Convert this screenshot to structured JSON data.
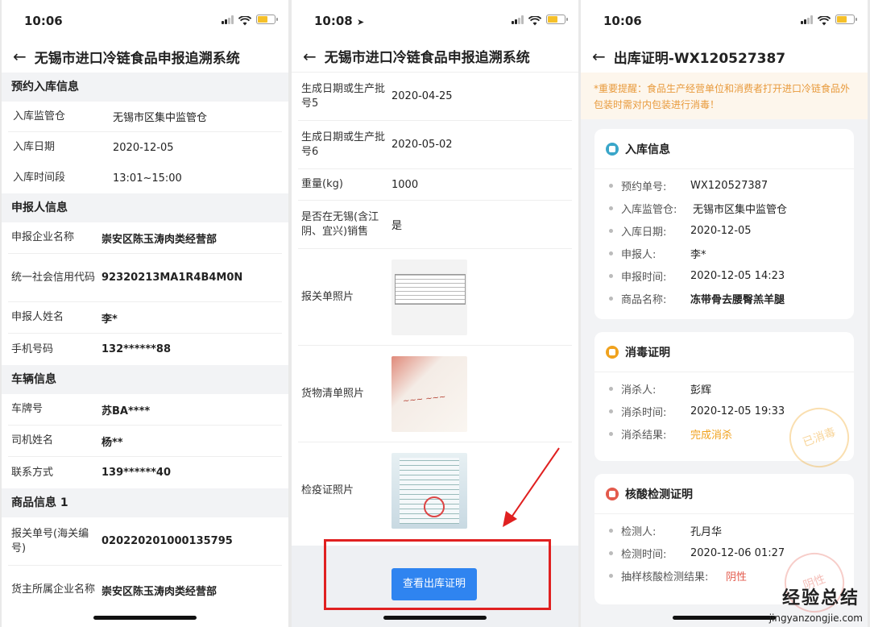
{
  "phone1": {
    "time": "10:06",
    "title": "无锡市进口冷链食品申报追溯系统",
    "section_booking": "预约入库信息",
    "booking": [
      {
        "k": "入库监管仓",
        "v": "无锡市区集中监管仓"
      },
      {
        "k": "入库日期",
        "v": "2020-12-05"
      },
      {
        "k": "入库时间段",
        "v": "13:01~15:00"
      }
    ],
    "section_declarer": "申报人信息",
    "declarer": [
      {
        "k": "申报企业名称",
        "v": "崇安区陈玉涛肉类经营部"
      },
      {
        "k": "统一社会信用代码",
        "v": "92320213MA1R4B4M0N"
      },
      {
        "k": "申报人姓名",
        "v": "李*"
      },
      {
        "k": "手机号码",
        "v": "132******88"
      }
    ],
    "section_vehicle": "车辆信息",
    "vehicle": [
      {
        "k": "车牌号",
        "v": "苏BA****"
      },
      {
        "k": "司机姓名",
        "v": "杨**"
      },
      {
        "k": "联系方式",
        "v": "139******40"
      }
    ],
    "section_goods": "商品信息 1",
    "goods": [
      {
        "k": "报关单号(海关编号)",
        "v": "020220201000135795"
      },
      {
        "k": "货主所属企业名称",
        "v": "崇安区陈玉涛肉类经营部"
      }
    ]
  },
  "phone2": {
    "time": "10:08",
    "title": "无锡市进口冷链食品申报追溯系统",
    "rows": [
      {
        "k": "生成日期或生产批号5",
        "v": "2020-04-25"
      },
      {
        "k": "生成日期或生产批号6",
        "v": "2020-05-02"
      },
      {
        "k": "重量(kg)",
        "v": "1000"
      },
      {
        "k": "是否在无锡(含江阴、宜兴)销售",
        "v": "是"
      }
    ],
    "photos": [
      {
        "k": "报关单照片"
      },
      {
        "k": "货物清单照片"
      },
      {
        "k": "检疫证照片"
      }
    ],
    "button": "查看出库证明"
  },
  "phone3": {
    "time": "10:06",
    "title": "出库证明-WX120527387",
    "notice": "*重要提醒：食品生产经营单位和消费者打开进口冷链食品外包装时需对内包装进行消毒！",
    "card_in": {
      "title": "入库信息",
      "items": [
        {
          "k": "预约单号:",
          "v": "WX120527387"
        },
        {
          "k": "入库监管仓:",
          "v": "无锡市区集中监管仓"
        },
        {
          "k": "入库日期:",
          "v": "2020-12-05"
        },
        {
          "k": "申报人:",
          "v": "李*"
        },
        {
          "k": "申报时间:",
          "v": "2020-12-05 14:23"
        },
        {
          "k": "商品名称:",
          "v": "冻带骨去腰臀羔羊腿"
        }
      ]
    },
    "card_disinfect": {
      "title": "消毒证明",
      "items": [
        {
          "k": "消杀人:",
          "v": "彭辉"
        },
        {
          "k": "消杀时间:",
          "v": "2020-12-05 19:33"
        },
        {
          "k": "消杀结果:",
          "v": "完成消杀"
        }
      ],
      "stamp": "已消毒"
    },
    "card_test": {
      "title": "核酸检测证明",
      "items": [
        {
          "k": "检测人:",
          "v": "孔月华"
        },
        {
          "k": "检测时间:",
          "v": "2020-12-06 01:27"
        },
        {
          "k": "抽样核酸检测结果:",
          "v": "阴性"
        }
      ],
      "stamp": "阴性"
    }
  },
  "watermark": {
    "main": "经验总结",
    "sub": "jingyanzongjie.com"
  }
}
